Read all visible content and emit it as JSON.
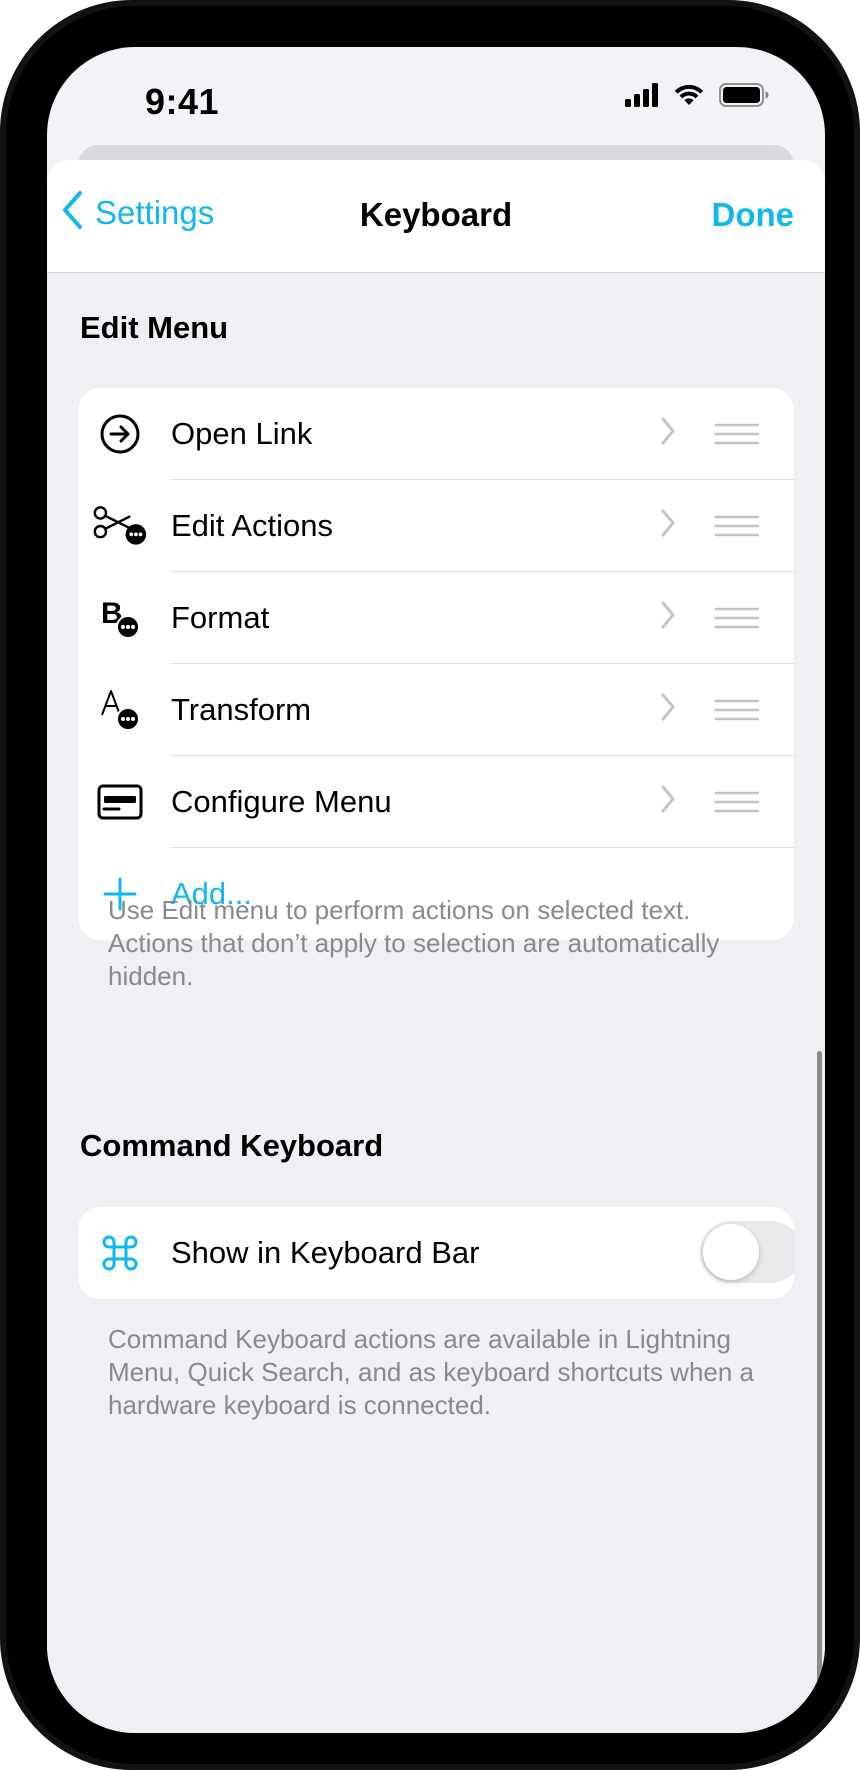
{
  "status_bar": {
    "time": "9:41",
    "icons": [
      "cellular-signal-icon",
      "wifi-icon",
      "battery-icon"
    ]
  },
  "nav": {
    "back_label": "Settings",
    "title": "Keyboard",
    "done_label": "Done"
  },
  "edit_menu": {
    "header": "Edit Menu",
    "items": [
      {
        "label": "Open Link",
        "icon": "arrow-circle-right-icon"
      },
      {
        "label": "Edit Actions",
        "icon": "scissors-ellipsis-icon"
      },
      {
        "label": "Format",
        "icon": "bold-ellipsis-icon"
      },
      {
        "label": "Transform",
        "icon": "letter-a-ellipsis-icon"
      },
      {
        "label": "Configure Menu",
        "icon": "menu-card-icon"
      }
    ],
    "add_label": "Add...",
    "footer": "Use Edit menu to perform actions on selected text. Actions that don’t apply to selection are automatically hidden."
  },
  "command_keyboard": {
    "header": "Command Keyboard",
    "item_label": "Show in Keyboard Bar",
    "item_icon": "command-key-icon",
    "toggle_on": false,
    "footer": "Command Keyboard actions are available in Lightning Menu, Quick Search, and as keyboard shortcuts when a hardware keyboard is connected."
  },
  "colors": {
    "accent": "#12b7ec",
    "background": "#efeff4",
    "secondary_text": "#8a8a8e"
  }
}
